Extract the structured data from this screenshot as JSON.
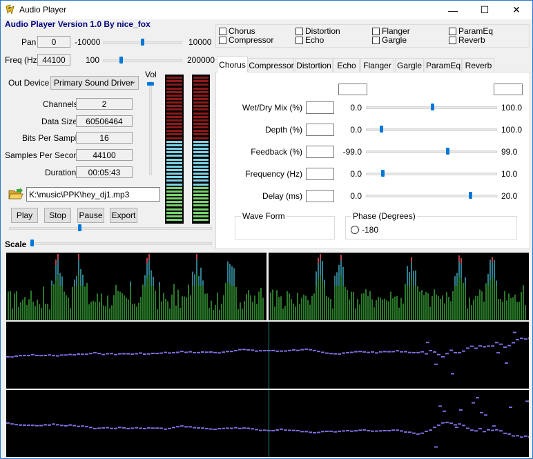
{
  "window": {
    "title": "Audio Player",
    "controls": {
      "minimize": "—",
      "maximize": "☐",
      "close": "✕"
    }
  },
  "header": {
    "version_text": "Audio Player Version 1.0 By nice_fox"
  },
  "pan": {
    "label": "Pan",
    "value": "0",
    "min": "-10000",
    "max": "10000",
    "position": 0.5
  },
  "freq": {
    "label": "Freq (Hz)",
    "value": "44100",
    "min": "100",
    "max": "200000",
    "position": 0.22
  },
  "output": {
    "label": "Out Device",
    "selected": "Primary Sound Driver"
  },
  "info": {
    "channels_label": "Channels",
    "channels": "2",
    "data_size_label": "Data Size",
    "data_size": "60506464",
    "bits_label": "Bits Per Sample",
    "bits": "16",
    "sps_label": "Samples Per Second",
    "sps": "44100",
    "duration_label": "Duration",
    "duration": "00:05:43"
  },
  "volume": {
    "label": "Vol",
    "level": 0.95
  },
  "file": {
    "path": "K:\\music\\PPK\\hey_dj1.mp3"
  },
  "buttons": {
    "play": "Play",
    "stop": "Stop",
    "pause": "Pause",
    "export": "Export"
  },
  "seek": {
    "position": 0.35
  },
  "scale": {
    "label": "Scale",
    "position": 0.0
  },
  "effects": {
    "chorus": "Chorus",
    "compressor": "Compressor",
    "distortion": "Distortion",
    "echo": "Echo",
    "flanger": "Flanger",
    "gargle": "Gargle",
    "parameq": "ParamEq",
    "reverb": "Reverb"
  },
  "tabs": [
    "Chorus",
    "Compressor",
    "Distortion",
    "Echo",
    "Flanger",
    "Gargle",
    "ParamEq",
    "Reverb"
  ],
  "chorus": {
    "params": [
      {
        "label": "Wet/Dry Mix (%)",
        "value": "",
        "min": "0.0",
        "max": "100.0",
        "position": 0.5
      },
      {
        "label": "Depth (%)",
        "value": "",
        "min": "0.0",
        "max": "100.0",
        "position": 0.1
      },
      {
        "label": "Feedback (%)",
        "value": "",
        "min": "-99.0",
        "max": "99.0",
        "position": 0.62
      },
      {
        "label": "Frequency (Hz)",
        "value": "",
        "min": "0.0",
        "max": "10.0",
        "position": 0.11
      },
      {
        "label": "Delay (ms)",
        "value": "",
        "min": "0.0",
        "max": "20.0",
        "position": 0.8
      }
    ],
    "waveform_label": "Wave Form",
    "phase_label": "Phase (Degrees)",
    "phase_option": "-180"
  },
  "colors": {
    "meter_red": "#8b1a1a",
    "meter_cyan": "#7fd3e6",
    "meter_green": "#78d26e",
    "bar_green": "#2a7a2a",
    "bar_teal": "#2f7f8f",
    "bar_red": "#c0404a",
    "wave_dot": "#7b6fe0",
    "cursor_line": "#1b8a8a"
  }
}
